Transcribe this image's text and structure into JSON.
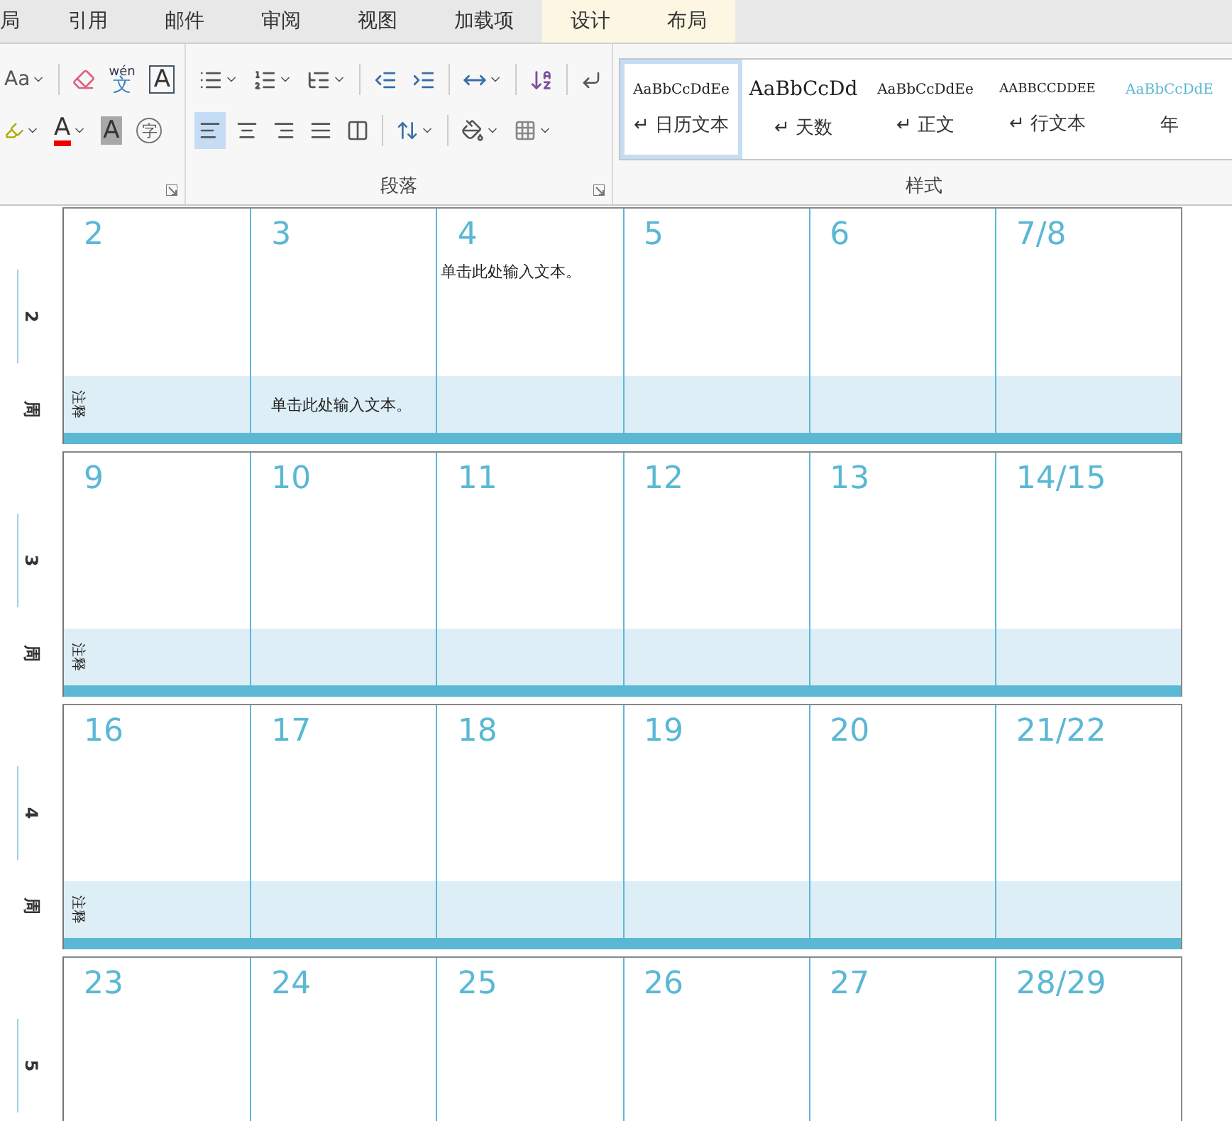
{
  "tabs": [
    {
      "label": "局",
      "contextual": false
    },
    {
      "label": "引用",
      "contextual": false
    },
    {
      "label": "邮件",
      "contextual": false
    },
    {
      "label": "审阅",
      "contextual": false
    },
    {
      "label": "视图",
      "contextual": false
    },
    {
      "label": "加载项",
      "contextual": false
    },
    {
      "label": "设计",
      "contextual": true
    },
    {
      "label": "布局",
      "contextual": true
    }
  ],
  "font_group": {
    "case_button": "Aa",
    "phonetic_top": "wén",
    "phonetic_char": "文",
    "bordered_char": "A",
    "font_color_char": "A",
    "shaded_char": "A",
    "enclosed_char": "字"
  },
  "paragraph_group": {
    "label": "段落",
    "align_buttons": [
      {
        "kind": "left",
        "selected": true
      },
      {
        "kind": "center",
        "selected": false
      },
      {
        "kind": "right",
        "selected": false
      },
      {
        "kind": "justify",
        "selected": false
      },
      {
        "kind": "distribute",
        "selected": false
      }
    ]
  },
  "styles_group": {
    "label": "样式",
    "items": [
      {
        "kind": "plain",
        "preview": "AaBbCcDdEe",
        "mark": "↵",
        "name": "日历文本",
        "selected": true
      },
      {
        "kind": "large",
        "preview": "AaBbCcDd",
        "mark": "↵",
        "name": "天数",
        "selected": false
      },
      {
        "kind": "plain",
        "preview": "AaBbCcDdEe",
        "mark": "↵",
        "name": "正文",
        "selected": false
      },
      {
        "kind": "caps",
        "preview": "AABBCCDDEE",
        "mark": "↵",
        "name": "行文本",
        "selected": false
      },
      {
        "kind": "accent",
        "preview": "AaBbCcDdE",
        "name": "年",
        "selected": false
      }
    ]
  },
  "weeks": [
    {
      "number": "2",
      "unit": "周",
      "note_label": "注释",
      "days": [
        {
          "day": "2"
        },
        {
          "day": "3",
          "note": "单击此处输入文本。"
        },
        {
          "day": "4",
          "text": "单击此处输入文本。"
        },
        {
          "day": "5"
        },
        {
          "day": "6"
        },
        {
          "day": "7/8"
        }
      ]
    },
    {
      "number": "3",
      "unit": "周",
      "note_label": "注释",
      "days": [
        {
          "day": "9"
        },
        {
          "day": "10"
        },
        {
          "day": "11"
        },
        {
          "day": "12"
        },
        {
          "day": "13"
        },
        {
          "day": "14/15"
        }
      ]
    },
    {
      "number": "4",
      "unit": "周",
      "note_label": "注释",
      "days": [
        {
          "day": "16"
        },
        {
          "day": "17"
        },
        {
          "day": "18"
        },
        {
          "day": "19"
        },
        {
          "day": "20"
        },
        {
          "day": "21/22"
        }
      ]
    },
    {
      "number": "5",
      "days": [
        {
          "day": "23"
        },
        {
          "day": "24"
        },
        {
          "day": "25"
        },
        {
          "day": "26"
        },
        {
          "day": "27"
        },
        {
          "day": "28/29"
        }
      ]
    }
  ]
}
